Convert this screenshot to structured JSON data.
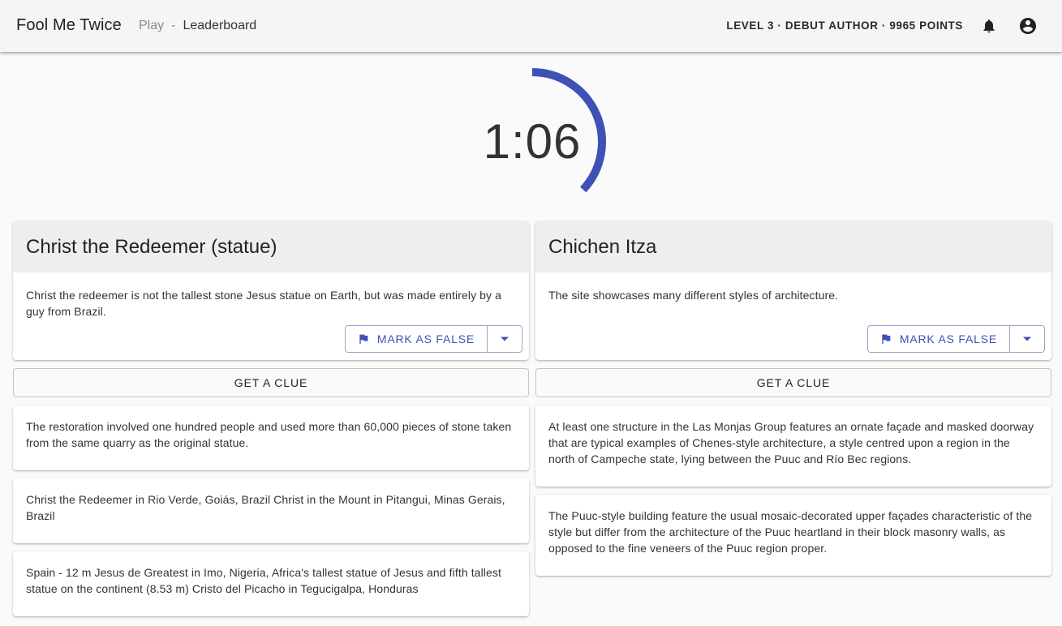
{
  "header": {
    "app_title": "Fool Me Twice",
    "nav": {
      "play": "Play",
      "separator": "-",
      "leaderboard": "Leaderboard"
    },
    "status": "LEVEL 3 · DEBUT AUTHOR · 9965 POINTS",
    "icons": [
      "bell-icon",
      "account-circle-icon"
    ]
  },
  "timer": {
    "text": "1:06",
    "remaining_fraction": 0.37,
    "color": "#3f51b5"
  },
  "colors": {
    "accent": "#3f51b5",
    "header_bg": "#f5f5f5",
    "card_header_bg": "#eeeeee"
  },
  "claims": [
    {
      "title": "Christ the Redeemer (statue)",
      "text": "Christ the redeemer is not the tallest stone Jesus statue on Earth, but was made entirely by a guy from Brazil.",
      "mark_button": "MARK AS FALSE",
      "clue_button": "GET A CLUE",
      "clues": [
        "The restoration involved one hundred people and used more than 60,000 pieces of stone taken from the same quarry as the original statue.",
        "Christ the Redeemer in Rio Verde, Goiás, Brazil Christ in the Mount in Pitangui, Minas Gerais, Brazil",
        "Spain - 12 m Jesus de Greatest in Imo, Nigeria, Africa's tallest statue of Jesus and fifth tallest statue on the continent (8.53 m) Cristo del Picacho in Tegucigalpa, Honduras"
      ]
    },
    {
      "title": "Chichen Itza",
      "text": "The site showcases many different styles of architecture.",
      "mark_button": "MARK AS FALSE",
      "clue_button": "GET A CLUE",
      "clues": [
        "At least one structure in the Las Monjas Group features an ornate façade and masked doorway that are typical examples of Chenes-style architecture, a style centred upon a region in the north of Campeche state, lying between the Puuc and Río Bec regions.",
        "The Puuc-style building feature the usual mosaic-decorated upper façades characteristic of the style but differ from the architecture of the Puuc heartland in their block masonry walls, as opposed to the fine veneers of the Puuc region proper."
      ]
    }
  ]
}
